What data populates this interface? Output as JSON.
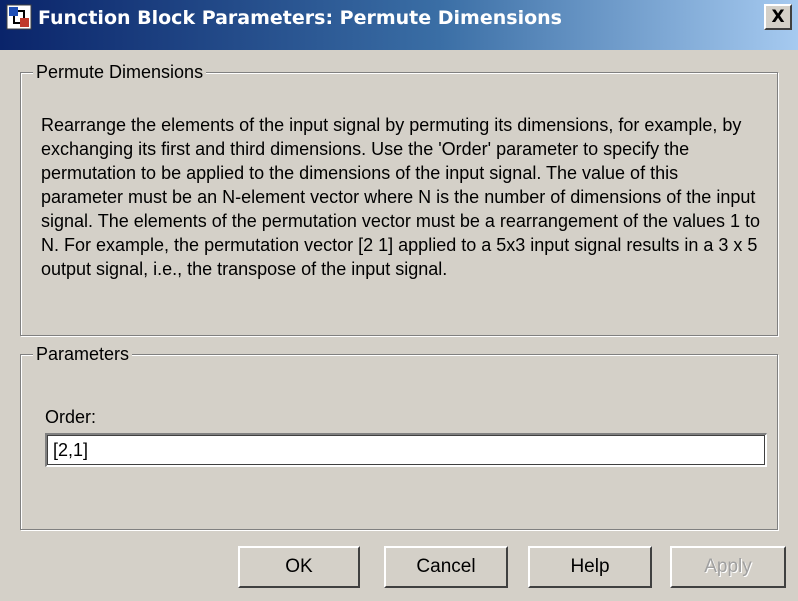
{
  "window": {
    "title": "Function Block Parameters: Permute Dimensions",
    "close_label": "X"
  },
  "description_group": {
    "legend": "Permute Dimensions",
    "text": "Rearrange the elements of the input signal by permuting its dimensions, for example, by exchanging its first and third dimensions. Use the 'Order' parameter to specify the permutation to be applied to the dimensions of the input signal. The value of this parameter must be an N-element vector where N is the number of dimensions of the input signal. The elements of the permutation vector must be a rearrangement of the values 1 to N. For example, the permutation vector [2 1] applied to a 5x3 input signal results in a 3 x 5 output signal, i.e., the transpose of the input signal."
  },
  "parameters_group": {
    "legend": "Parameters",
    "order_label": "Order:",
    "order_value": "[2,1]"
  },
  "buttons": {
    "ok": "OK",
    "cancel": "Cancel",
    "help": "Help",
    "apply": "Apply",
    "apply_enabled": false
  },
  "icons": {
    "app": "simulink-block-icon",
    "close": "close-icon"
  }
}
